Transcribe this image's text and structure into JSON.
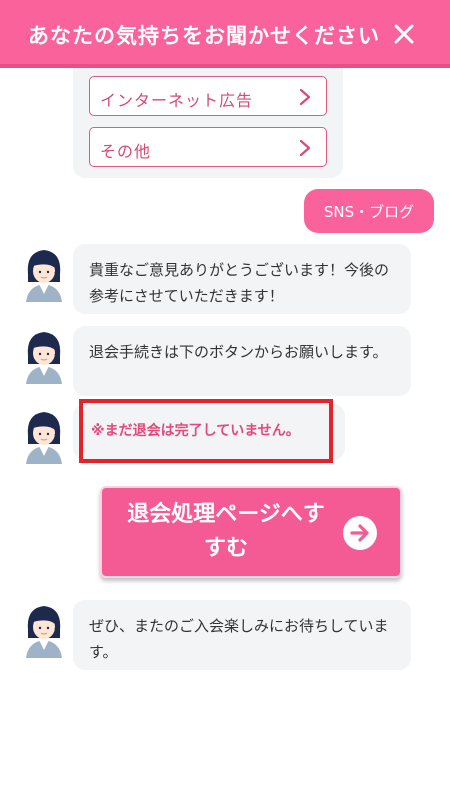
{
  "header": {
    "title": "あなたの気持ちをお聞かせください",
    "close_icon": "close-icon"
  },
  "options": [
    {
      "label": "インターネット広告"
    },
    {
      "label": "その他"
    }
  ],
  "user_message": "SNS・ブログ",
  "bot_messages": [
    "貴重なご意見ありがとうございます！今後の参考にさせていただきます！",
    "退会手続きは下のボタンからお願いします。"
  ],
  "warning": "※まだ退会は完了していません。",
  "cta": {
    "label": "退会処理ページへすすむ"
  },
  "final_message": "ぜひ、またのご入会楽しみにお待ちしています。",
  "colors": {
    "brand": "#f9629a",
    "warning_border": "#e5222a",
    "bubble": "#f2f4f5"
  }
}
